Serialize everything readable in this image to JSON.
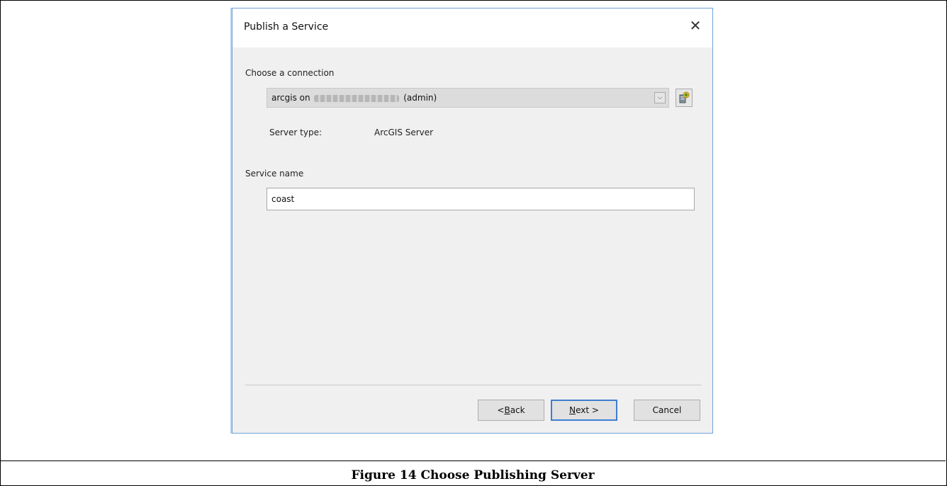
{
  "dialog": {
    "title": "Publish a Service",
    "connection_label": "Choose a connection",
    "connection_value_prefix": "arcgis on",
    "connection_value_suffix": "(admin)",
    "server_type_label": "Server type:",
    "server_type_value": "ArcGIS Server",
    "service_name_label": "Service name",
    "service_name_value": "coast",
    "buttons": {
      "back_prefix": "< ",
      "back_accel": "B",
      "back_rest": "ack",
      "next_accel": "N",
      "next_rest": "ext >",
      "cancel": "Cancel"
    }
  },
  "caption": "Figure 14 Choose Publishing Server"
}
